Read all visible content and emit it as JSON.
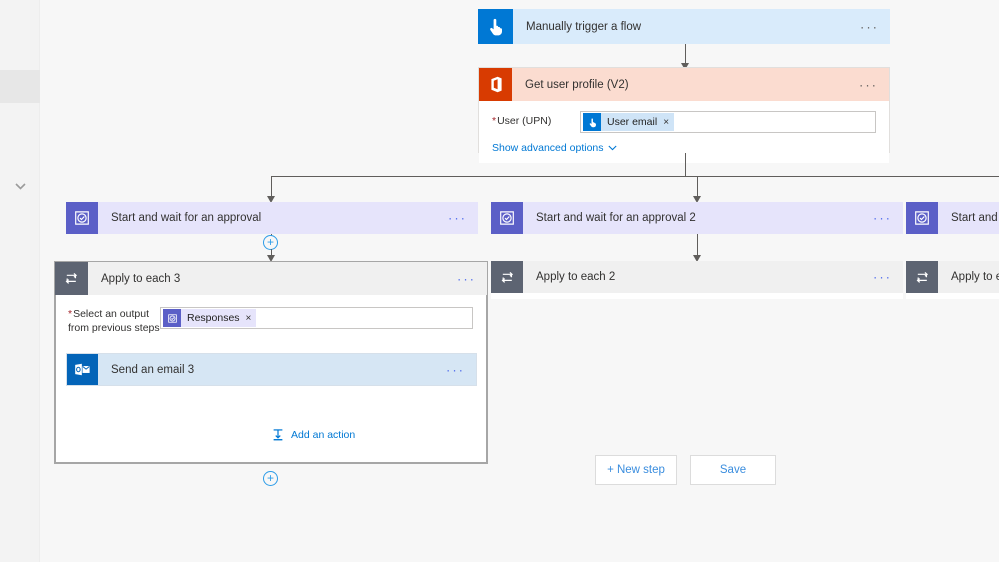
{
  "rail": {
    "chevron_icon": "chevron-down-icon"
  },
  "flow": {
    "trigger": {
      "title": "Manually trigger a flow",
      "icon": "manual-trigger-hand-icon",
      "more_label": "···"
    },
    "get_user_profile": {
      "title": "Get user profile (V2)",
      "icon": "office365-users-icon",
      "more_label": "···",
      "field_label": "User (UPN)",
      "required_marker": "*",
      "token": {
        "label": "User email",
        "icon": "manual-trigger-hand-icon",
        "remove_label": "×"
      },
      "advanced_link": "Show advanced options",
      "advanced_chevron": "chevron-down-icon"
    },
    "branches": [
      {
        "approval": {
          "title": "Start and wait for an approval",
          "icon": "approvals-icon",
          "more_label": "···"
        },
        "loop": {
          "title": "Apply to each 3",
          "icon": "apply-to-each-loop-icon",
          "more_label": "···",
          "field_label": "Select an output from previous steps",
          "required_marker": "*",
          "token": {
            "label": "Responses",
            "icon": "approvals-icon",
            "remove_label": "×"
          },
          "inner_action": {
            "title": "Send an email 3",
            "icon": "outlook-icon",
            "more_label": "···"
          },
          "add_action_label": "Add an action",
          "add_action_icon": "add-action-icon"
        }
      },
      {
        "approval": {
          "title": "Start and wait for an approval 2",
          "icon": "approvals-icon",
          "more_label": "···"
        },
        "loop": {
          "title": "Apply to each 2",
          "icon": "apply-to-each-loop-icon",
          "more_label": "···"
        }
      },
      {
        "approval": {
          "title": "Start and wait",
          "icon": "approvals-icon",
          "more_label": "···"
        },
        "loop": {
          "title": "Apply to each",
          "icon": "apply-to-each-loop-icon",
          "more_label": "···"
        }
      }
    ]
  },
  "footer": {
    "new_step_label": "+ New step",
    "save_label": "Save"
  },
  "colors": {
    "trigger_blue": "#0078d4",
    "office_orange": "#d83b01",
    "approval_purple": "#5b5fc7",
    "loop_slate": "#5d6472",
    "outlook_blue": "#0364b8",
    "link_blue": "#0078d4",
    "required_red": "#a4262c"
  }
}
